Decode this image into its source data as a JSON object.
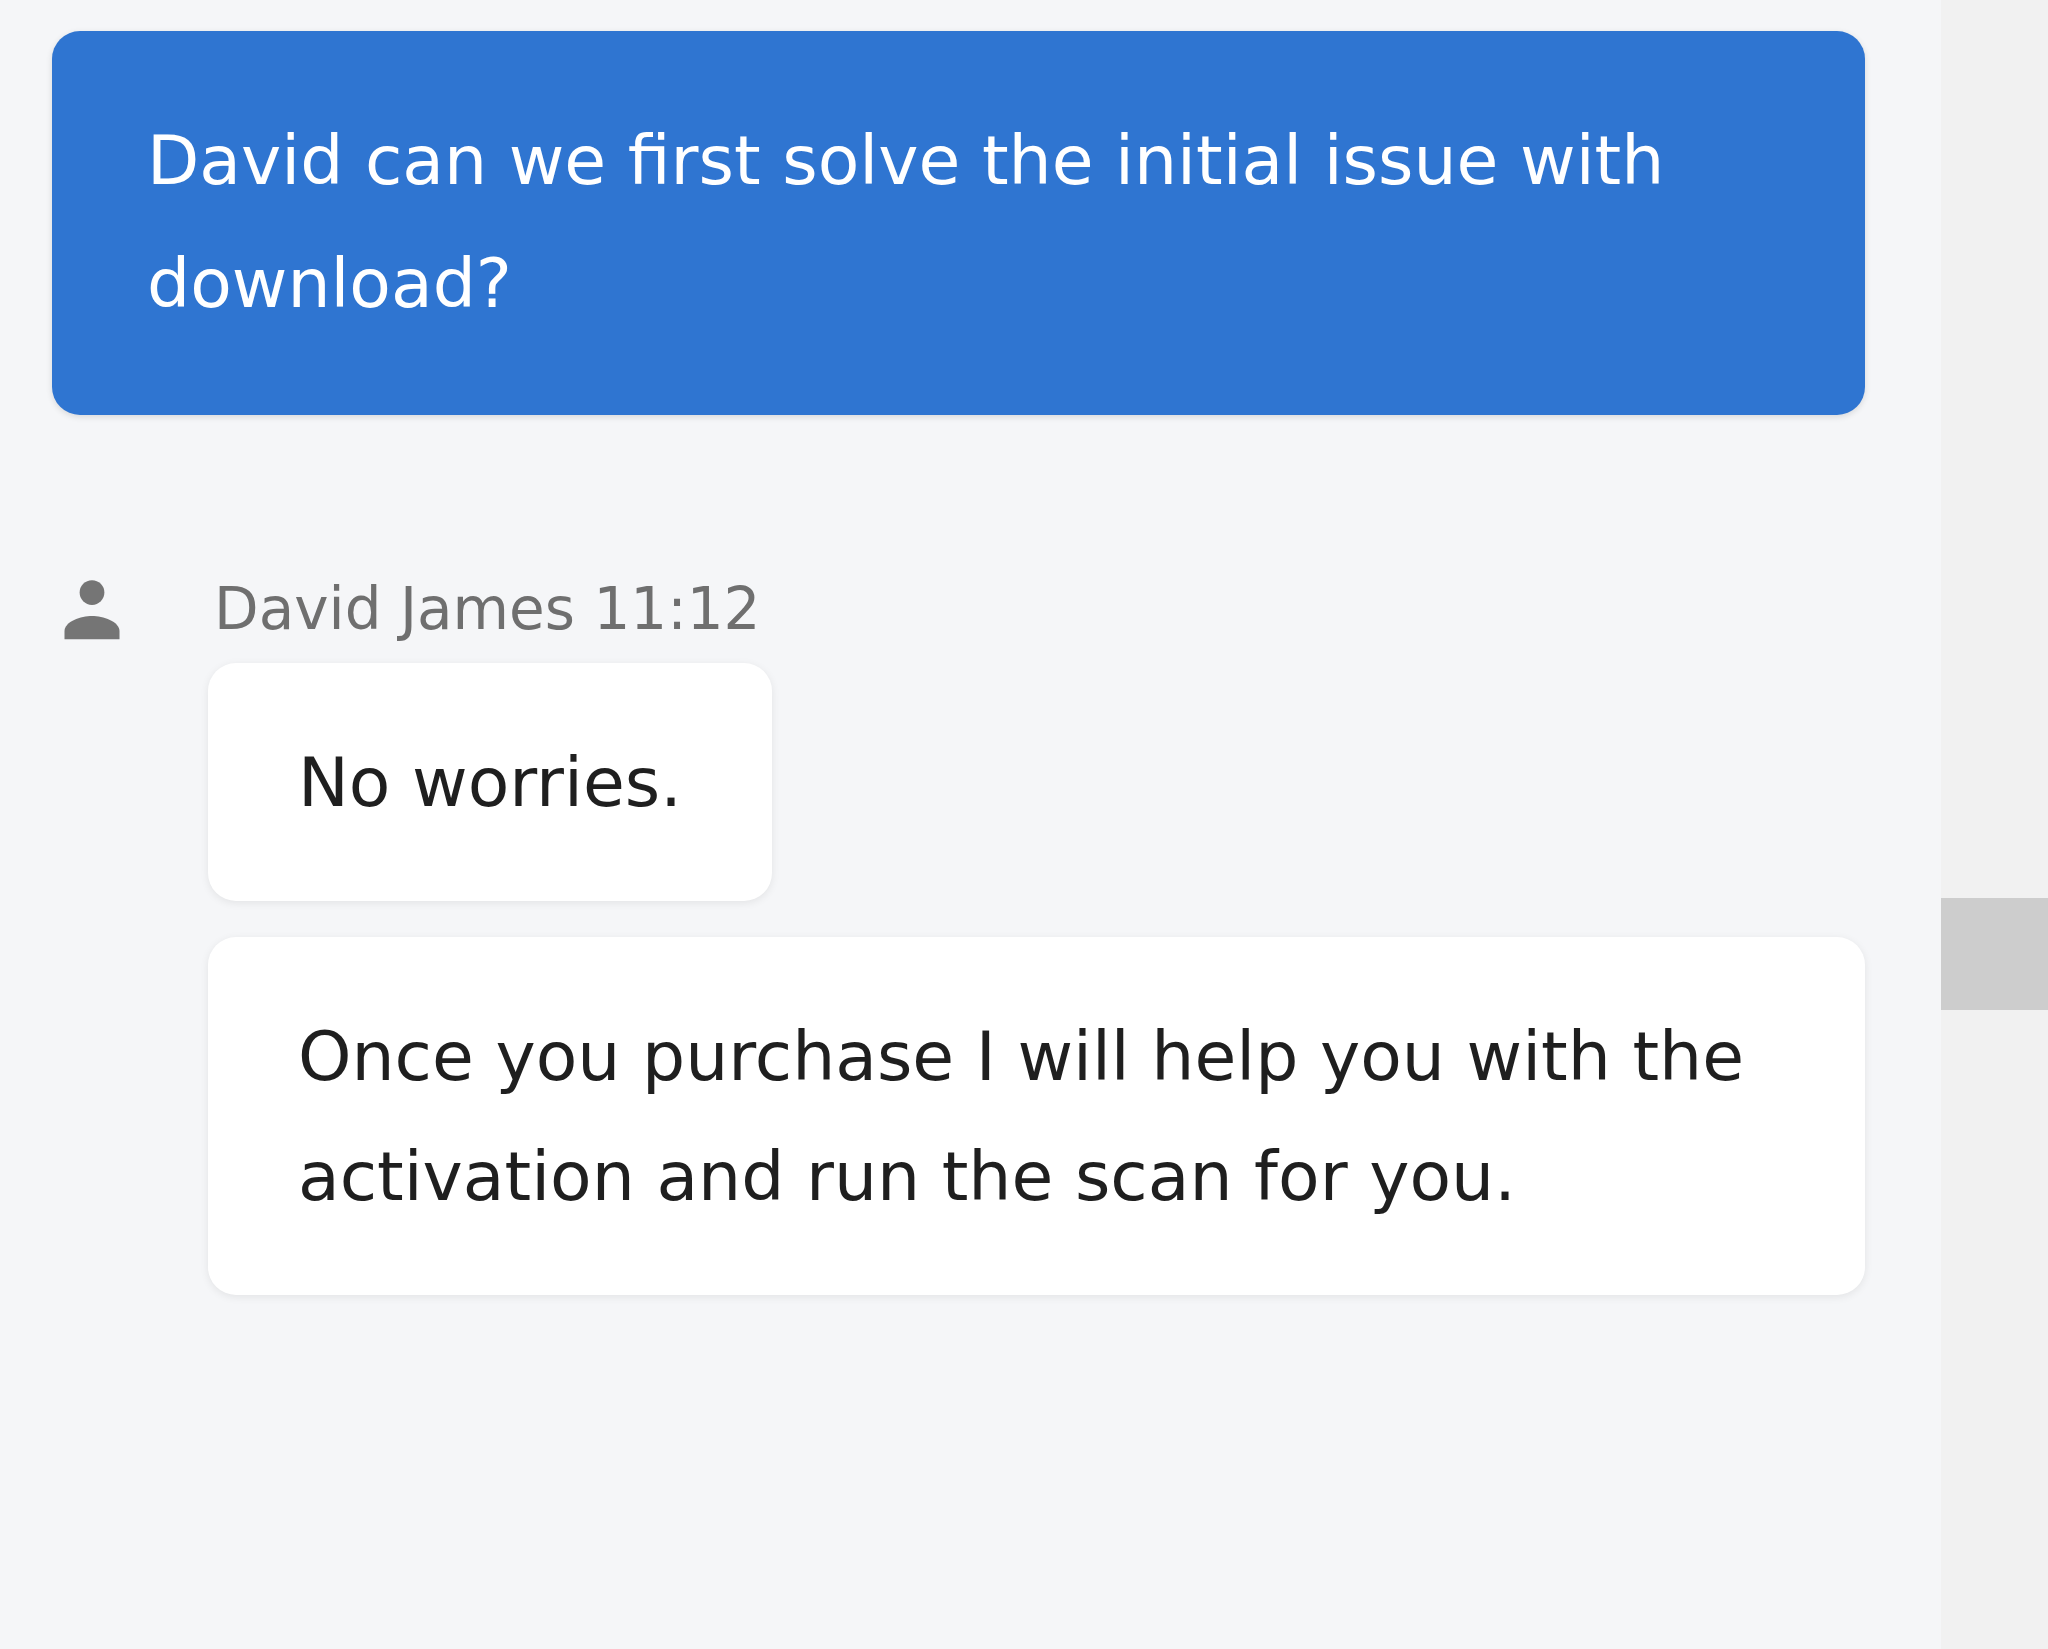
{
  "messages": [
    {
      "kind": "outgoing",
      "text": "David can we first solve the initial issue with download?"
    },
    {
      "kind": "incoming",
      "sender": "David James",
      "time": "11:12",
      "bubbles": [
        "No worries.",
        "Once you purchase I will help you with the activation and run the scan for you."
      ]
    }
  ]
}
